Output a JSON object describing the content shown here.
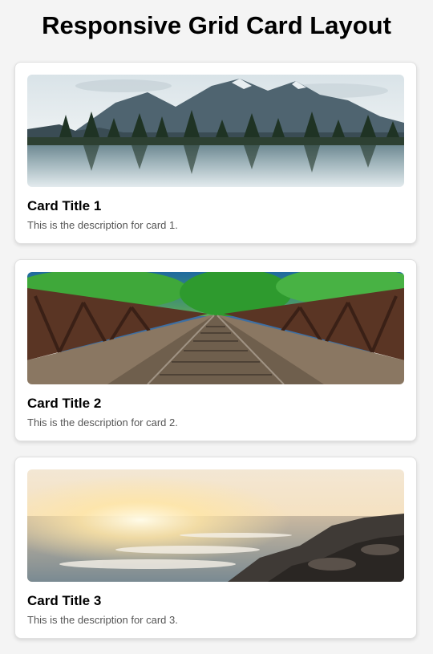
{
  "page": {
    "title": "Responsive Grid Card Layout"
  },
  "cards": [
    {
      "title": "Card Title 1",
      "description": "This is the description for card 1.",
      "image": "mountain-lake-photo"
    },
    {
      "title": "Card Title 2",
      "description": "This is the description for card 2.",
      "image": "railway-bridge-photo"
    },
    {
      "title": "Card Title 3",
      "description": "This is the description for card 3.",
      "image": "sunset-seashore-photo"
    }
  ],
  "colors": {
    "page_background": "#f4f4f4",
    "card_background": "#ffffff",
    "title_text": "#000000",
    "description_text": "#555555"
  }
}
